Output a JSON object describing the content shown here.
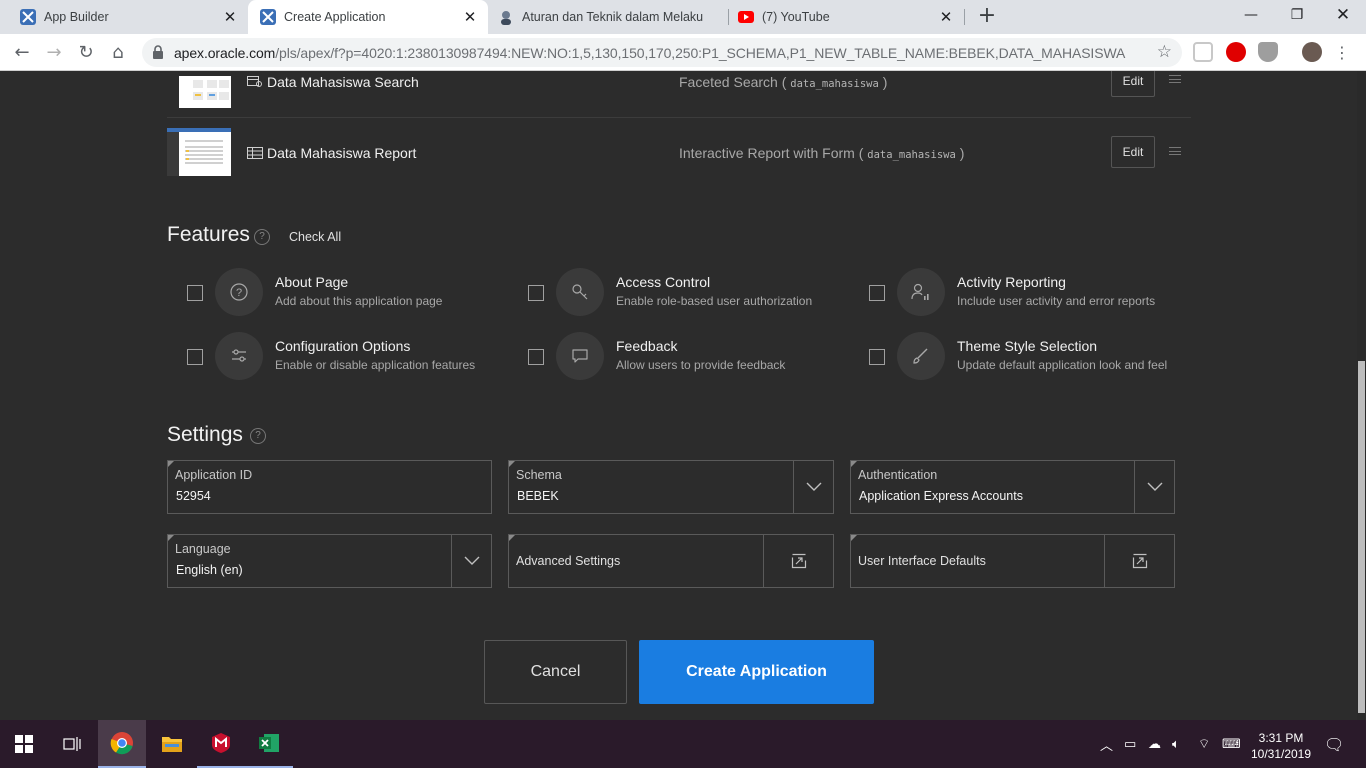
{
  "browser": {
    "tabs": [
      {
        "title": "App Builder",
        "active": false
      },
      {
        "title": "Create Application",
        "active": true
      },
      {
        "title": "Aturan dan Teknik dalam Melaku",
        "active": false
      },
      {
        "title": "(7) YouTube",
        "active": false
      }
    ],
    "url_host": "apex.oracle.com",
    "url_path": "/pls/apex/f?p=4020:1:2380130987494:NEW:NO:1,5,130,150,170,250:P1_SCHEMA,P1_NEW_TABLE_NAME:BEBEK,DATA_MAHASISWA"
  },
  "pages": [
    {
      "name": "Data Mahasiswa Search",
      "type": "Faceted Search (",
      "table": "data_mahasiswa",
      "close": ")",
      "edit": "Edit"
    },
    {
      "name": "Data Mahasiswa Report",
      "type": "Interactive Report with Form (",
      "table": "data_mahasiswa",
      "close": ")",
      "edit": "Edit"
    }
  ],
  "features": {
    "title": "Features",
    "check_all": "Check All",
    "items": [
      {
        "title": "About Page",
        "desc": "Add about this application page",
        "icon": "question-circle-icon",
        "checked": false
      },
      {
        "title": "Access Control",
        "desc": "Enable role-based user authorization",
        "icon": "key-icon",
        "checked": false
      },
      {
        "title": "Activity Reporting",
        "desc": "Include user activity and error reports",
        "icon": "user-chart-icon",
        "checked": false
      },
      {
        "title": "Configuration Options",
        "desc": "Enable or disable application features",
        "icon": "sliders-icon",
        "checked": false
      },
      {
        "title": "Feedback",
        "desc": "Allow users to provide feedback",
        "icon": "comment-icon",
        "checked": false
      },
      {
        "title": "Theme Style Selection",
        "desc": "Update default application look and feel",
        "icon": "brush-icon",
        "checked": false
      }
    ]
  },
  "settings": {
    "title": "Settings",
    "application_id": {
      "label": "Application ID",
      "value": "52954"
    },
    "schema": {
      "label": "Schema",
      "value": "BEBEK"
    },
    "authentication": {
      "label": "Authentication",
      "value": "Application Express Accounts"
    },
    "language": {
      "label": "Language",
      "value": "English (en)"
    },
    "advanced": "Advanced Settings",
    "ui_defaults": "User Interface Defaults"
  },
  "actions": {
    "cancel": "Cancel",
    "create": "Create Application"
  },
  "taskbar": {
    "time": "3:31 PM",
    "date": "10/31/2019"
  },
  "colors": {
    "accent": "#1a7de1",
    "page_bg": "#2c2c2c"
  }
}
